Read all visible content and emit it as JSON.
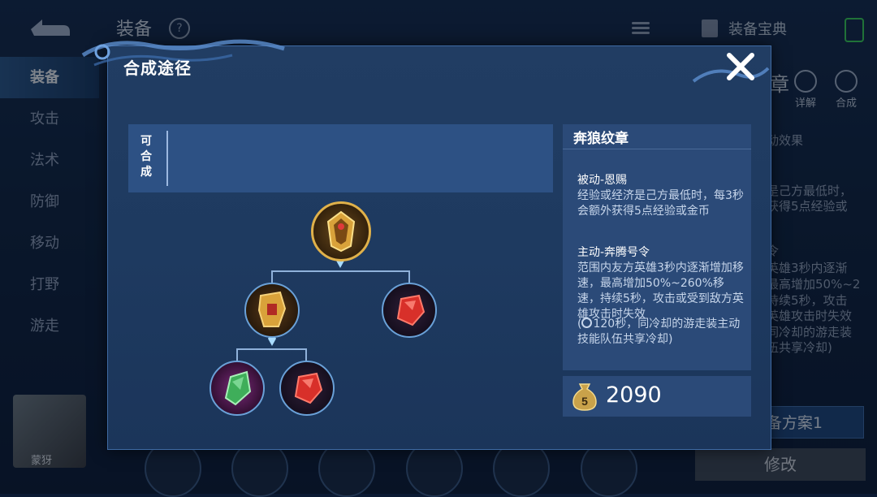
{
  "background": {
    "title": "装备",
    "help_glyph": "?",
    "guide_label": "装备宝典",
    "sidebar": [
      "装备",
      "攻击",
      "法术",
      "防御",
      "移动",
      "打野",
      "游走"
    ],
    "right_title": "章",
    "actions": [
      "详解",
      "合成"
    ],
    "right_texts": [
      "动效果",
      "是己方最低时，",
      "获得5点经验或",
      "令",
      "英雄3秒内逐渐",
      "最高增加50%~2",
      "持续5秒，攻击",
      "英雄攻击时失效",
      "同冷却的游走装",
      "伍共享冷却)"
    ],
    "plan_button": "备方案1",
    "edit_button": "修改",
    "avatar_name": "蒙犽"
  },
  "modal": {
    "title": "合成途径",
    "compose_label": "可合成"
  },
  "tree": {
    "root": "wolf-emblem",
    "level2": [
      "golden-gauntlet",
      "red-gem"
    ],
    "level3": [
      "green-leaf-gem",
      "red-gem"
    ]
  },
  "info": {
    "name": "奔狼纹章",
    "passive_title": "被动-恩赐",
    "passive_text": "经验或经济是己方最低时，每3秒会额外获得5点经验或金币",
    "active_title": "主动-奔腾号令",
    "active_text": "范围内友方英雄3秒内逐渐增加移速，最高增加50%~260%移速，持续5秒，攻击或受到敌方英雄攻击时失效",
    "cooldown_text": "120秒，同冷却的游走装主动技能队伍共享冷却)",
    "cooldown_prefix": "("
  },
  "price": {
    "bag_digit": "5",
    "value": "2090"
  },
  "colors": {
    "modal_bg": "#213d63",
    "panel_bg": "#2b4a78",
    "line": "#8fb1da",
    "gold": "#d9a23a",
    "red_gem": "#d8302a",
    "green_gem": "#3fae5a"
  }
}
